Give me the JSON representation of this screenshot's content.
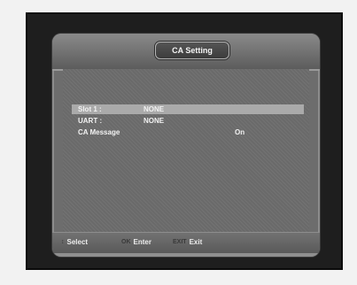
{
  "header": {
    "title": "CA Setting"
  },
  "menu": {
    "rows": [
      {
        "label": "Slot 1 :",
        "value": "NONE",
        "selected": true
      },
      {
        "label": "UART :",
        "value": "NONE",
        "selected": false
      },
      {
        "label": "CA Message",
        "value": "On",
        "selected": false
      }
    ]
  },
  "footer": {
    "hints": [
      {
        "key": "↕",
        "label": "Select",
        "key_icon": "updown-arrow-icon"
      },
      {
        "key": "OK",
        "label": "Enter",
        "key_icon": "ok-key-icon"
      },
      {
        "key": "EXIT",
        "label": "Exit",
        "key_icon": "exit-key-icon"
      }
    ]
  }
}
